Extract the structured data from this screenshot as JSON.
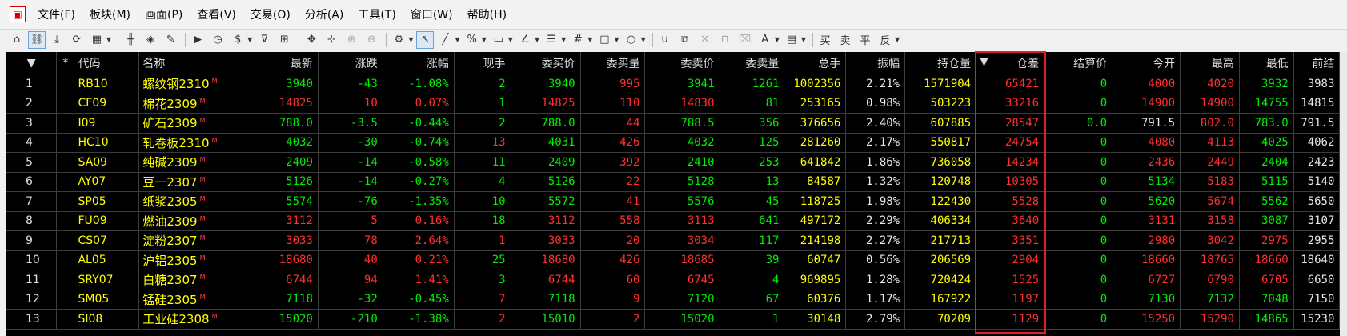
{
  "menu": {
    "items": [
      "文件(F)",
      "板块(M)",
      "画面(P)",
      "查看(V)",
      "交易(O)",
      "分析(A)",
      "工具(T)",
      "窗口(W)",
      "帮助(H)"
    ]
  },
  "toolbar": {
    "dollar_label": "$",
    "percent_label": "%",
    "text_buttons": [
      "买",
      "卖",
      "平",
      "反"
    ]
  },
  "table": {
    "header_sort_marker": "▼",
    "star": "*",
    "sorted_marker": "▼",
    "columns": [
      "代码",
      "名称",
      "最新",
      "涨跌",
      "涨幅",
      "现手",
      "委买价",
      "委买量",
      "委卖价",
      "委卖量",
      "总手",
      "振幅",
      "持仓量",
      "仓差",
      "结算价",
      "今开",
      "最高",
      "最低",
      "前结"
    ],
    "main_marker": "M",
    "rows": [
      {
        "idx": "1",
        "code": "RB10",
        "name": "螺纹钢2310",
        "last": "3940",
        "chg": "-43",
        "pct": "-1.08%",
        "vol_now": "2",
        "bid": "3940",
        "bid_qty": "995",
        "ask": "3941",
        "ask_qty": "1261",
        "total": "1002356",
        "amp": "2.21%",
        "oi": "1571904",
        "oi_chg": "65421",
        "settle": "0",
        "open": "4000",
        "high": "4020",
        "low": "3932",
        "pre": "3983"
      },
      {
        "idx": "2",
        "code": "CF09",
        "name": "棉花2309",
        "last": "14825",
        "chg": "10",
        "pct": "0.07%",
        "vol_now": "1",
        "bid": "14825",
        "bid_qty": "110",
        "ask": "14830",
        "ask_qty": "81",
        "total": "253165",
        "amp": "0.98%",
        "oi": "503223",
        "oi_chg": "33216",
        "settle": "0",
        "open": "14900",
        "high": "14900",
        "low": "14755",
        "pre": "14815"
      },
      {
        "idx": "3",
        "code": "I09",
        "name": "矿石2309",
        "last": "788.0",
        "chg": "-3.5",
        "pct": "-0.44%",
        "vol_now": "2",
        "bid": "788.0",
        "bid_qty": "44",
        "ask": "788.5",
        "ask_qty": "356",
        "total": "376656",
        "amp": "2.40%",
        "oi": "607885",
        "oi_chg": "28547",
        "settle": "0.0",
        "open": "791.5",
        "high": "802.0",
        "low": "783.0",
        "pre": "791.5"
      },
      {
        "idx": "4",
        "code": "HC10",
        "name": "轧卷板2310",
        "last": "4032",
        "chg": "-30",
        "pct": "-0.74%",
        "vol_now": "13",
        "bid": "4031",
        "bid_qty": "426",
        "ask": "4032",
        "ask_qty": "125",
        "total": "281260",
        "amp": "2.17%",
        "oi": "550817",
        "oi_chg": "24754",
        "settle": "0",
        "open": "4080",
        "high": "4113",
        "low": "4025",
        "pre": "4062"
      },
      {
        "idx": "5",
        "code": "SA09",
        "name": "纯碱2309",
        "last": "2409",
        "chg": "-14",
        "pct": "-0.58%",
        "vol_now": "11",
        "bid": "2409",
        "bid_qty": "392",
        "ask": "2410",
        "ask_qty": "253",
        "total": "641842",
        "amp": "1.86%",
        "oi": "736058",
        "oi_chg": "14234",
        "settle": "0",
        "open": "2436",
        "high": "2449",
        "low": "2404",
        "pre": "2423"
      },
      {
        "idx": "6",
        "code": "AY07",
        "name": "豆一2307",
        "last": "5126",
        "chg": "-14",
        "pct": "-0.27%",
        "vol_now": "4",
        "bid": "5126",
        "bid_qty": "22",
        "ask": "5128",
        "ask_qty": "13",
        "total": "84587",
        "amp": "1.32%",
        "oi": "120748",
        "oi_chg": "10305",
        "settle": "0",
        "open": "5134",
        "high": "5183",
        "low": "5115",
        "pre": "5140"
      },
      {
        "idx": "7",
        "code": "SP05",
        "name": "纸浆2305",
        "last": "5574",
        "chg": "-76",
        "pct": "-1.35%",
        "vol_now": "10",
        "bid": "5572",
        "bid_qty": "41",
        "ask": "5576",
        "ask_qty": "45",
        "total": "118725",
        "amp": "1.98%",
        "oi": "122430",
        "oi_chg": "5528",
        "settle": "0",
        "open": "5620",
        "high": "5674",
        "low": "5562",
        "pre": "5650"
      },
      {
        "idx": "8",
        "code": "FU09",
        "name": "燃油2309",
        "last": "3112",
        "chg": "5",
        "pct": "0.16%",
        "vol_now": "18",
        "bid": "3112",
        "bid_qty": "558",
        "ask": "3113",
        "ask_qty": "641",
        "total": "497172",
        "amp": "2.29%",
        "oi": "406334",
        "oi_chg": "3640",
        "settle": "0",
        "open": "3131",
        "high": "3158",
        "low": "3087",
        "pre": "3107"
      },
      {
        "idx": "9",
        "code": "CS07",
        "name": "淀粉2307",
        "last": "3033",
        "chg": "78",
        "pct": "2.64%",
        "vol_now": "1",
        "bid": "3033",
        "bid_qty": "20",
        "ask": "3034",
        "ask_qty": "117",
        "total": "214198",
        "amp": "2.27%",
        "oi": "217713",
        "oi_chg": "3351",
        "settle": "0",
        "open": "2980",
        "high": "3042",
        "low": "2975",
        "pre": "2955"
      },
      {
        "idx": "10",
        "code": "AL05",
        "name": "沪铝2305",
        "last": "18680",
        "chg": "40",
        "pct": "0.21%",
        "vol_now": "25",
        "bid": "18680",
        "bid_qty": "426",
        "ask": "18685",
        "ask_qty": "39",
        "total": "60747",
        "amp": "0.56%",
        "oi": "206569",
        "oi_chg": "2904",
        "settle": "0",
        "open": "18660",
        "high": "18765",
        "low": "18660",
        "pre": "18640"
      },
      {
        "idx": "11",
        "code": "SRY07",
        "name": "白糖2307",
        "last": "6744",
        "chg": "94",
        "pct": "1.41%",
        "vol_now": "3",
        "bid": "6744",
        "bid_qty": "60",
        "ask": "6745",
        "ask_qty": "4",
        "total": "969895",
        "amp": "1.28%",
        "oi": "720424",
        "oi_chg": "1525",
        "settle": "0",
        "open": "6727",
        "high": "6790",
        "low": "6705",
        "pre": "6650"
      },
      {
        "idx": "12",
        "code": "SM05",
        "name": "锰硅2305",
        "last": "7118",
        "chg": "-32",
        "pct": "-0.45%",
        "vol_now": "7",
        "bid": "7118",
        "bid_qty": "9",
        "ask": "7120",
        "ask_qty": "67",
        "total": "60376",
        "amp": "1.17%",
        "oi": "167922",
        "oi_chg": "1197",
        "settle": "0",
        "open": "7130",
        "high": "7132",
        "low": "7048",
        "pre": "7150"
      },
      {
        "idx": "13",
        "code": "SI08",
        "name": "工业硅2308",
        "last": "15020",
        "chg": "-210",
        "pct": "-1.38%",
        "vol_now": "2",
        "bid": "15010",
        "bid_qty": "2",
        "ask": "15020",
        "ask_qty": "1",
        "total": "30148",
        "amp": "2.79%",
        "oi": "70209",
        "oi_chg": "1129",
        "settle": "0",
        "open": "15250",
        "high": "15290",
        "low": "14865",
        "pre": "15230"
      }
    ]
  },
  "colors": {
    "up": "#ff3030",
    "down": "#00ee00",
    "neutral": "#e8e8e8",
    "code": "#ffff00",
    "background": "#000000",
    "highlight_border": "#e02020"
  }
}
